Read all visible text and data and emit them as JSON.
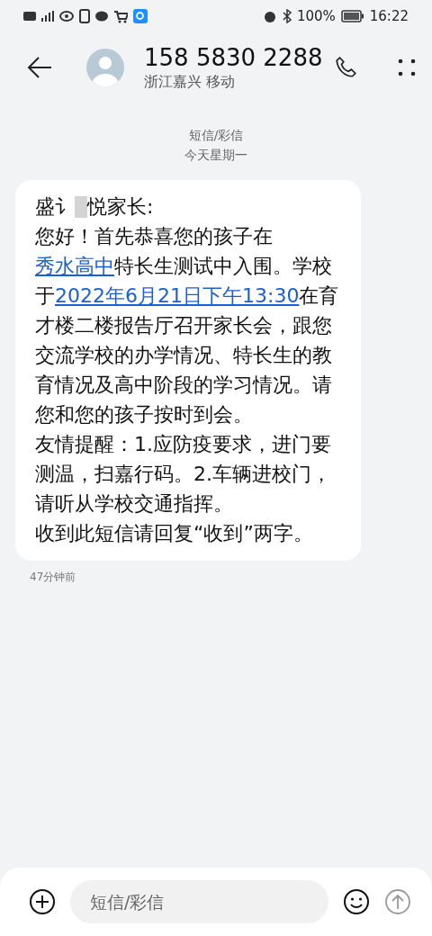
{
  "status_bar": {
    "battery": "100%",
    "time": "16:22"
  },
  "header": {
    "contact": "158 5830 2288",
    "subtitle": "浙江嘉兴 移动"
  },
  "thread": {
    "channel": "短信/彩信",
    "date": "今天星期一"
  },
  "message": {
    "greeting_before": "盛讠",
    "greeting_after": "悦家长:",
    "redacted": true,
    "paragraphs": [
      [
        {
          "text": "您好！首先恭喜您的孩子在",
          "link": false
        },
        {
          "text": "秀水高中",
          "link": true
        },
        {
          "text": "特长生测试中入围。学校于",
          "link": false
        },
        {
          "text": "2022年6月21日下午13:30",
          "link": true
        },
        {
          "text": "在育才楼二楼报告厅召开家长会，跟您交流学校的办学情况、特长生的教育情况及高中阶段的学习情况。请您和您的孩子按时到会。",
          "link": false
        }
      ],
      [
        {
          "text": "友情提醒：1.应防疫要求，进门要测温，扫嘉行码。2.车辆进校门，请听从学校交通指挥。",
          "link": false
        }
      ],
      [
        {
          "text": "收到此短信请回复“收到”两字。",
          "link": false
        }
      ]
    ],
    "time": "47分钟前"
  },
  "composer": {
    "placeholder": "短信/彩信",
    "send_disabled": true
  }
}
